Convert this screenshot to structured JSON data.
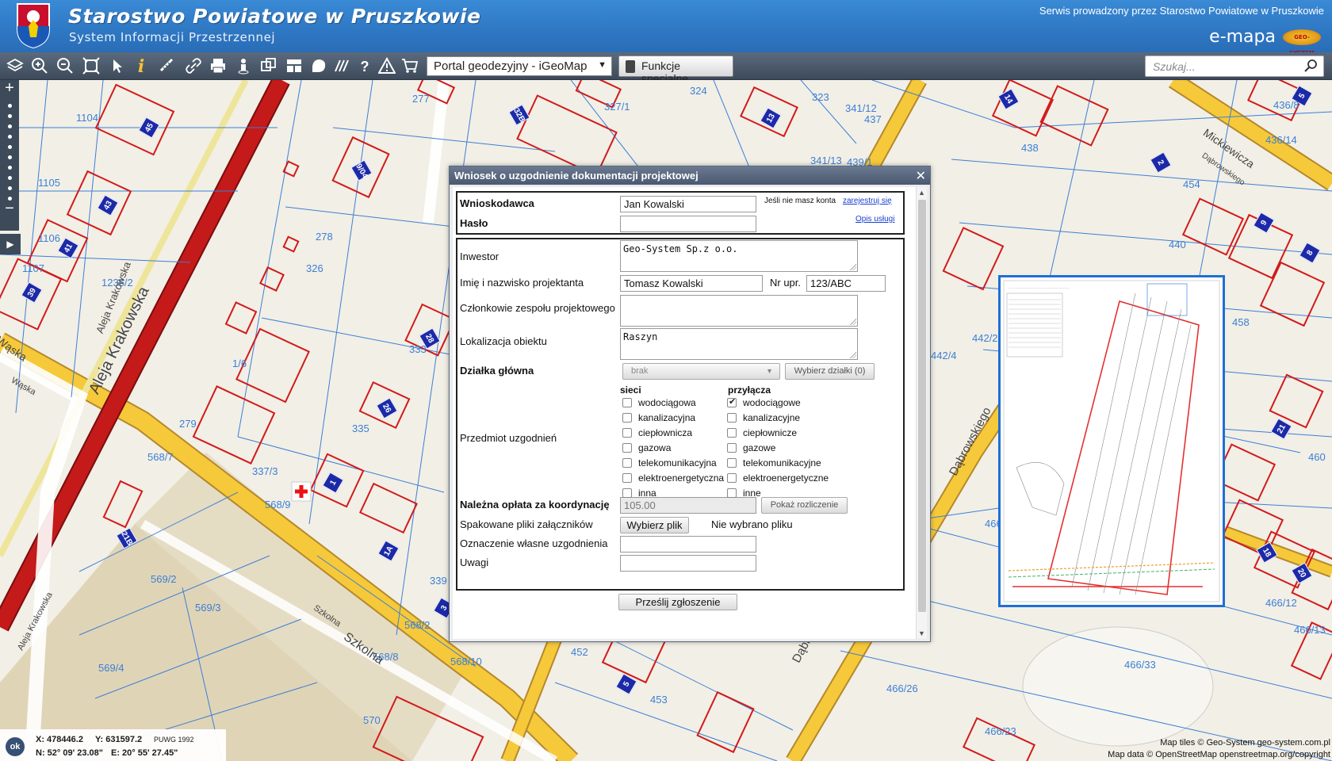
{
  "header": {
    "title": "Starostwo Powiatowe w Pruszkowie",
    "subtitle": "System Informacji Przestrzennej",
    "service_note": "Serwis prowadzony przez Starostwo Powiatowe w Pruszkowie",
    "logo_text": "e-mapa",
    "logo_badge": "GEO-SYSTEM"
  },
  "toolbar": {
    "icons": [
      "layers-icon",
      "zoom-in-icon",
      "zoom-out-icon",
      "zoom-extent-icon",
      "select-icon",
      "info-icon",
      "measure-icon",
      "link-icon",
      "print-icon",
      "streetview-icon",
      "compare-icon",
      "layout-icon",
      "shape-icon",
      "hatch-icon",
      "help-icon",
      "warning-icon",
      "cart-icon"
    ],
    "portal_select": "Portal geodezyjny - iGeoMap",
    "special_button": "Funkcje specjalne",
    "search_placeholder": "Szukaj..."
  },
  "dialog": {
    "title": "Wniosek o uzgodnienie dokumentacji projektowej",
    "login": {
      "applicant_label": "Wnioskodawca",
      "applicant_value": "Jan Kowalski",
      "password_label": "Hasło",
      "password_value": "",
      "register_note": "Jeśli nie masz konta",
      "register_link": "zarejestruj się",
      "service_link": "Opis usługi"
    },
    "form": {
      "investor_label": "Inwestor",
      "investor_value": "Geo-System Sp.z o.o.",
      "designer_label": "Imię i nazwisko projektanta",
      "designer_value": "Tomasz Kowalski",
      "license_label": "Nr upr.",
      "license_value": "123/ABC",
      "team_label": "Członkowie zespołu projektowego",
      "team_value": "",
      "location_label": "Lokalizacja obiektu",
      "location_value": "Raszyn",
      "plot_label": "Działka główna",
      "plot_value": "brak",
      "choose_plots_button": "Wybierz działki (0)",
      "subject_label": "Przedmiot uzgodnień",
      "networks_header": "sieci",
      "connections_header": "przyłącza",
      "networks": [
        {
          "label": "wodociągowa",
          "checked": false
        },
        {
          "label": "kanalizacyjna",
          "checked": false
        },
        {
          "label": "ciepłownicza",
          "checked": false
        },
        {
          "label": "gazowa",
          "checked": false
        },
        {
          "label": "telekomunikacyjna",
          "checked": false
        },
        {
          "label": "elektroenergetyczna",
          "checked": false
        },
        {
          "label": "inna",
          "checked": false
        }
      ],
      "connections": [
        {
          "label": "wodociągowe",
          "checked": true
        },
        {
          "label": "kanalizacyjne",
          "checked": false
        },
        {
          "label": "ciepłownicze",
          "checked": false
        },
        {
          "label": "gazowe",
          "checked": false
        },
        {
          "label": "telekomunikacyjne",
          "checked": false
        },
        {
          "label": "elektroenergetyczne",
          "checked": false
        },
        {
          "label": "inne",
          "checked": false
        }
      ],
      "fee_label": "Należna opłata za koordynację",
      "fee_value": "105.00",
      "fee_button": "Pokaż rozliczenie",
      "files_label": "Spakowane pliki załączników",
      "files_button": "Wybierz plik",
      "files_status": "Nie wybrano pliku",
      "own_id_label": "Oznaczenie własne uzgodnienia",
      "own_id_value": "",
      "notes_label": "Uwagi",
      "notes_value": "",
      "submit_button": "Prześlij  zgłoszenie"
    }
  },
  "map": {
    "street_labels": [
      "Aleja Krakowska",
      "Aleja Krakowska",
      "Aleja Krakowska",
      "Wąska",
      "Wąska",
      "Szkolna",
      "Szkolna",
      "Mickiewicza",
      "Dąbrowskiego",
      "Dąbrowskiego",
      "Dąbrowskiego"
    ],
    "parcel_labels": [
      "1104",
      "1105",
      "1106",
      "1107",
      "1236/2",
      "278",
      "326",
      "277",
      "327/1",
      "324",
      "323",
      "341/12",
      "341/13",
      "437",
      "439/1",
      "436/8",
      "436/14",
      "438",
      "454",
      "440",
      "442/2",
      "442/4",
      "458",
      "460",
      "333",
      "1/6",
      "279",
      "335",
      "337/3",
      "568/7",
      "568/9",
      "339",
      "568/2",
      "568/8",
      "568/10",
      "569/2",
      "569/3",
      "569/4",
      "570",
      "452",
      "453",
      "466/21",
      "466/10",
      "466/11",
      "466/12",
      "466/13",
      "466/33",
      "466/26",
      "466/23"
    ],
    "building_numbers": [
      "45",
      "43",
      "41",
      "39",
      "9/04",
      "32B",
      "13",
      "14",
      "5",
      "2",
      "9",
      "8",
      "28",
      "26",
      "1",
      "1A",
      "21B",
      "5",
      "21",
      "18",
      "20",
      "3"
    ]
  },
  "status": {
    "ok_button": "ok",
    "x_coord": "X: 478446.2",
    "y_coord": "Y: 631597.2",
    "crs": "PUWG 1992",
    "lat": "N: 52° 09' 23.08\"",
    "lon": "E: 20° 55' 27.45\"",
    "copyright_tiles": "Map tiles © Geo-System geo-system.com.pl",
    "copyright_data": "Map data © OpenStreetMap openstreetmap.org/copyright"
  }
}
